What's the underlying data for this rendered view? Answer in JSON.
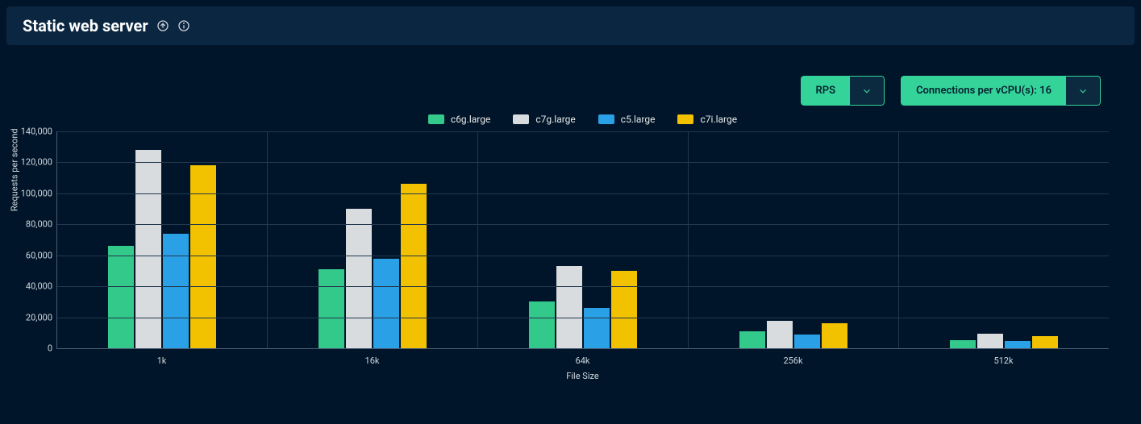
{
  "header": {
    "title": "Static web server"
  },
  "controls": {
    "metric_label": "RPS",
    "connections_label": "Connections per vCPU(s): 16"
  },
  "legend_labels": [
    "c6g.large",
    "c7g.large",
    "c5.large",
    "c7i.large"
  ],
  "chart_data": {
    "type": "bar",
    "title": "Static web server",
    "xlabel": "File Size",
    "ylabel": "Requests per second",
    "ylim": [
      0,
      140000
    ],
    "y_ticks": [
      0,
      20000,
      40000,
      60000,
      80000,
      100000,
      120000,
      140000
    ],
    "y_tick_labels": [
      "0",
      "20,000",
      "40,000",
      "60,000",
      "80,000",
      "100,000",
      "120,000",
      "140,000"
    ],
    "categories": [
      "1k",
      "16k",
      "64k",
      "256k",
      "512k"
    ],
    "series": [
      {
        "name": "c6g.large",
        "color": "#33c98a",
        "values": [
          66000,
          51000,
          30000,
          11000,
          5000
        ]
      },
      {
        "name": "c7g.large",
        "color": "#d9dcdf",
        "values": [
          128000,
          90000,
          53000,
          17500,
          9500
        ]
      },
      {
        "name": "c5.large",
        "color": "#2aa0e6",
        "values": [
          74000,
          58000,
          26000,
          9000,
          4500
        ]
      },
      {
        "name": "c7i.large",
        "color": "#f2c200",
        "values": [
          118000,
          106000,
          50000,
          16000,
          8000
        ]
      }
    ]
  }
}
